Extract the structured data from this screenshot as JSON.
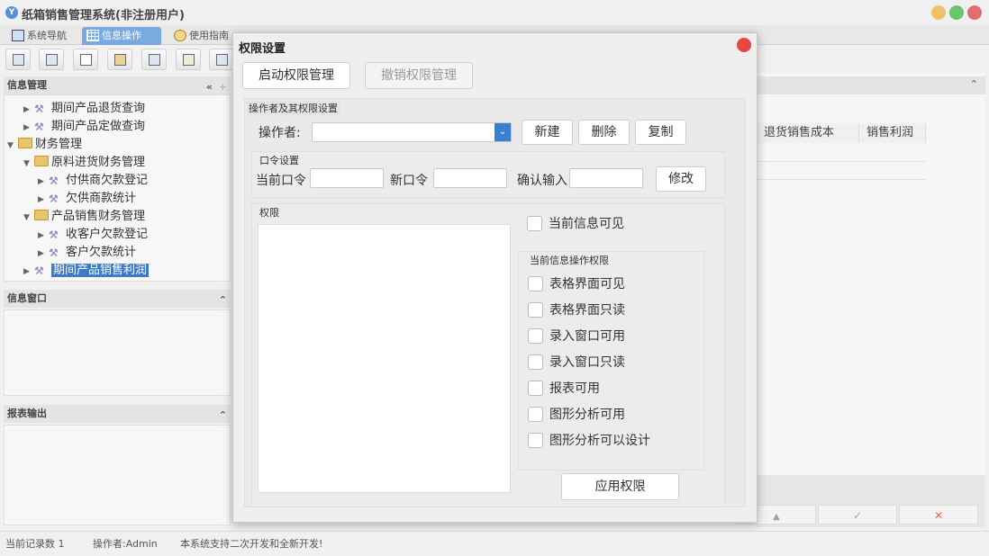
{
  "app": {
    "title": "纸箱销售管理系统(非注册用户)",
    "icon_letter": "Y"
  },
  "window_buttons": [
    {
      "name": "minimize-button",
      "color": "#f0c267"
    },
    {
      "name": "maximize-button",
      "color": "#6cc46c"
    },
    {
      "name": "close-window-button",
      "color": "#e36c6c"
    }
  ],
  "tabs": [
    {
      "label": "系统导航",
      "active": false
    },
    {
      "label": "信息操作",
      "active": true
    },
    {
      "label": "使用指南",
      "active": false
    }
  ],
  "left_panel": {
    "info_mgmt_title": "信息管理",
    "info_window_title": "信息窗口",
    "report_title": "报表输出",
    "tree": [
      {
        "label": "期间产品退货查询",
        "level": 1,
        "type": "tool"
      },
      {
        "label": "期间产品定做查询",
        "level": 1,
        "type": "tool"
      },
      {
        "label": "财务管理",
        "level": 0,
        "type": "folder",
        "expanded": true
      },
      {
        "label": "原料进货财务管理",
        "level": 1,
        "type": "folder",
        "expanded": true
      },
      {
        "label": "付供商欠款登记",
        "level": 2,
        "type": "tool"
      },
      {
        "label": "欠供商款统计",
        "level": 2,
        "type": "tool"
      },
      {
        "label": "产品销售财务管理",
        "level": 1,
        "type": "folder",
        "expanded": true
      },
      {
        "label": "收客户欠款登记",
        "level": 2,
        "type": "tool"
      },
      {
        "label": "客户欠款统计",
        "level": 2,
        "type": "tool"
      },
      {
        "label": "期间产品销售利润",
        "level": 1,
        "type": "tool",
        "selected": true
      }
    ]
  },
  "grid": {
    "columns": [
      "退货销售成本",
      "销售利润"
    ]
  },
  "status_bar": {
    "record_count": "当前记录数 1",
    "operator": "操作者:Admin",
    "message": "本系统支持二次开发和全新开发!"
  },
  "dialog": {
    "title": "权限设置",
    "enable_button": "启动权限管理",
    "revoke_button": "撤销权限管理",
    "operator_group_title": "操作者及其权限设置",
    "operator_label": "操作者:",
    "operator_value": "",
    "new_button": "新建",
    "delete_button": "删除",
    "copy_button": "复制",
    "password_group_title": "口令设置",
    "current_password_label": "当前口令",
    "new_password_label": "新口令",
    "confirm_label": "确认输入",
    "modify_button": "修改",
    "permissions_group_title": "权限",
    "current_info_visible": "当前信息可见",
    "ops_group_title": "当前信息操作权限",
    "ops": [
      "表格界面可见",
      "表格界面只读",
      "录入窗口可用",
      "录入窗口只读",
      "报表可用",
      "图形分析可用",
      "图形分析可以设计"
    ],
    "apply_button": "应用权限"
  },
  "right_controls": {
    "up": "▲",
    "check": "✓",
    "cancel": "✕"
  }
}
